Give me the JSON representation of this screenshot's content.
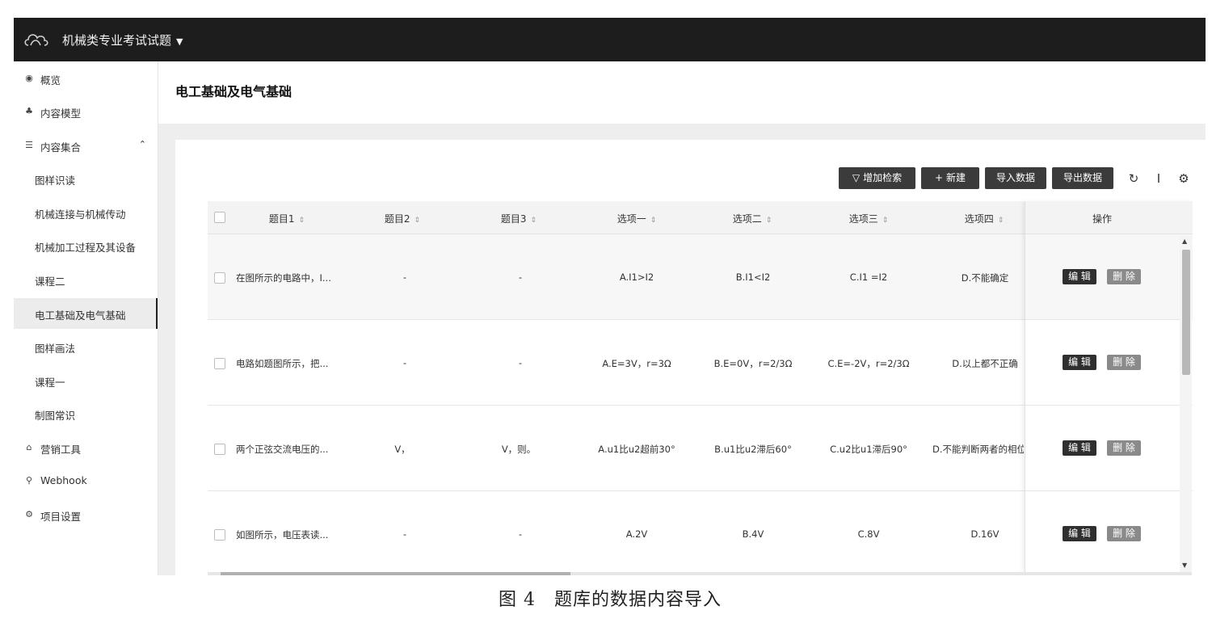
{
  "app": {
    "title": "机械类专业考试试题"
  },
  "sidebar": {
    "items": [
      {
        "label": "概览",
        "icon": "eye-icon"
      },
      {
        "label": "内容模型",
        "icon": "model-icon"
      },
      {
        "label": "内容集合",
        "icon": "list-icon",
        "expanded": true
      },
      {
        "label": "图样识读"
      },
      {
        "label": "机械连接与机械传动"
      },
      {
        "label": "机械加工过程及其设备"
      },
      {
        "label": "课程二"
      },
      {
        "label": "电工基础及电气基础",
        "active": true
      },
      {
        "label": "图样画法"
      },
      {
        "label": "课程一"
      },
      {
        "label": "制图常识"
      },
      {
        "label": "营销工具",
        "icon": "bag-icon"
      },
      {
        "label": "Webhook",
        "icon": "webhook-icon"
      },
      {
        "label": "项目设置",
        "icon": "gear-icon"
      }
    ]
  },
  "page": {
    "title": "电工基础及电气基础"
  },
  "toolbar": {
    "filter_label": "增加检索",
    "new_label": "新建",
    "import_label": "导入数据",
    "export_label": "导出数据"
  },
  "table": {
    "columns": [
      "题目1",
      "题目2",
      "题目3",
      "选项一",
      "选项二",
      "选项三",
      "选项四"
    ],
    "action_header": "操作",
    "rows": [
      [
        "在图所示的电路中，I...",
        "-",
        "-",
        "A.I1>I2",
        "B.I1<I2",
        "C.I1 =I2",
        "D.不能确定"
      ],
      [
        "电路如题图所示，把...",
        "-",
        "-",
        "A.E=3V，r=3Ω",
        "B.E=0V，r=2/3Ω",
        "C.E=-2V，r=2/3Ω",
        "D.以上都不正确"
      ],
      [
        "两个正弦交流电压的...",
        "V，",
        "V，则。",
        "A.u1比u2超前30°",
        "B.u1比u2滞后60°",
        "C.u2比u1滞后90°",
        "D.不能判断两者的相位"
      ],
      [
        "如图所示，电压表读...",
        "-",
        "-",
        "A.2V",
        "B.4V",
        "C.8V",
        "D.16V"
      ]
    ],
    "edit_label": "编 辑",
    "delete_label": "删 除"
  },
  "caption": "图 4　题库的数据内容导入",
  "colors": {
    "header": "#1d1d1d",
    "button": "#3b3b3b",
    "delete": "#8a8a8a"
  }
}
